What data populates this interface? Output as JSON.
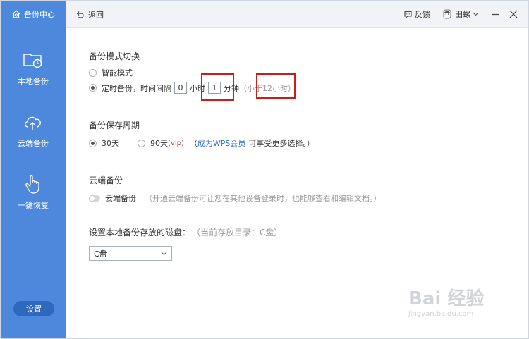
{
  "sidebar": {
    "brand": "备份中心",
    "items": [
      {
        "label": "本地备份",
        "icon": "folder-clock-icon"
      },
      {
        "label": "云端备份",
        "icon": "cloud-upload-icon"
      },
      {
        "label": "一键恢复",
        "icon": "hand-pointer-icon"
      }
    ],
    "settings_label": "设置"
  },
  "header": {
    "back_label": "返回",
    "feedback_label": "反馈",
    "user_name": "田螺"
  },
  "backup_mode": {
    "title": "备份模式切换",
    "smart_label": "智能模式",
    "smart_checked": false,
    "timed_label": "定时备份，时间间隔",
    "timed_checked": true,
    "hours_value": "0",
    "hours_unit": "小时",
    "minutes_value": "1",
    "minutes_unit": "分钟",
    "hint": "（小于12小时）"
  },
  "retention": {
    "title": "备份保存周期",
    "option_30": "30天",
    "option_30_checked": true,
    "option_90": "90天",
    "option_90_vip": "(vip)",
    "paren_open": "（",
    "link": "成为WPS会员",
    "suffix": "可享受更多选择。）"
  },
  "cloud": {
    "title": "云端备份",
    "toggle_label": "云端备份",
    "toggle_on": false,
    "description": "（开通云端备份可让您在其他设备登录时，也能够查看和编辑文档。）"
  },
  "disk": {
    "title": "设置本地备份存放的磁盘：",
    "current": "（当前存放目录：C盘）",
    "selected": "C盘"
  },
  "watermark": {
    "main": "Bai 经验",
    "sub": "jingyan.baidu.com"
  }
}
